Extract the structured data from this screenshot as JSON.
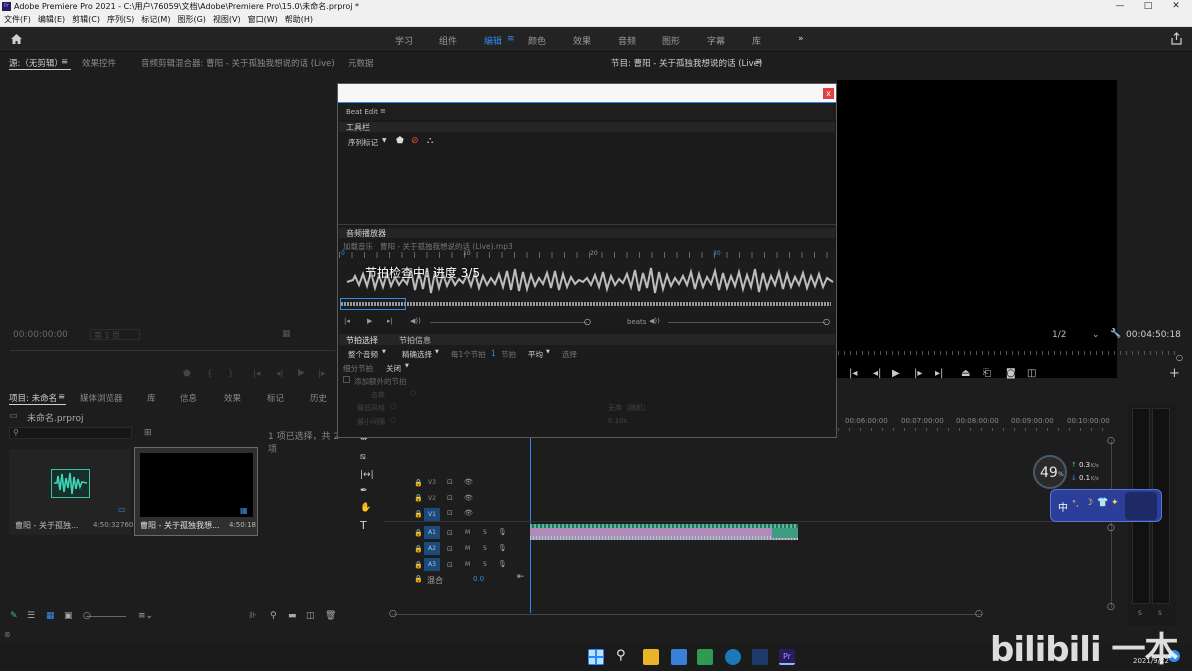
{
  "window": {
    "title": "Adobe Premiere Pro 2021 - C:\\用户\\76059\\文档\\Adobe\\Premiere Pro\\15.0\\未命名.prproj *",
    "minimize": "—",
    "maximize": "□",
    "close": "✕"
  },
  "menu": [
    "文件(F)",
    "编辑(E)",
    "剪辑(C)",
    "序列(S)",
    "标记(M)",
    "图形(G)",
    "视图(V)",
    "窗口(W)",
    "帮助(H)"
  ],
  "workspaces": {
    "items": [
      "学习",
      "组件",
      "编辑",
      "颜色",
      "效果",
      "音频",
      "图形",
      "字幕",
      "库"
    ],
    "active": "编辑",
    "more": "»"
  },
  "source_panel": {
    "tabs": [
      "源:（无剪辑）",
      "效果控件",
      "音频剪辑混合器: 曹阳 - 关于孤独我想说的话 (Live)",
      "元数据"
    ],
    "timecode": "00:00:00:00",
    "page": "第 1 页"
  },
  "program_panel": {
    "tab": "节目: 曹阳 - 关于孤独我想说的话 (Live)",
    "resolution": "1/2",
    "timecode": "00:04:50:18"
  },
  "project_panel": {
    "tabs": [
      "项目: 未命名",
      "媒体浏览器",
      "库",
      "信息",
      "效果",
      "标记",
      "历史"
    ],
    "file": "未命名.prproj",
    "selection": "1 项已选择，共 2 项",
    "items": [
      {
        "name": "曹阳 - 关于孤独...",
        "duration": "4:50:32760"
      },
      {
        "name": "曹阳 - 关于孤独我想...",
        "duration": "4:50:18"
      }
    ]
  },
  "beat_edit": {
    "title": "Beat Edit",
    "menu_icon": "≡",
    "close": "x",
    "toolbar": {
      "label": "工具栏",
      "sequence_marker": "序列标记"
    },
    "player": {
      "label": "音频播放器",
      "loaded_prefix": "加载音乐",
      "loaded_file": "曹阳 - 关于孤独我想说的话 (Live).mp3",
      "progress": "节拍检查中: 进度 3/5",
      "ruler": [
        "0",
        "10",
        "20",
        "30"
      ],
      "beats_label": "beats"
    },
    "tabs": [
      "节拍选择",
      "节拍信息"
    ],
    "selection": {
      "scope": "整个音频",
      "mode": "精确选择",
      "every": "每1个节拍",
      "count": "1",
      "unit": "节拍",
      "avg": "平均",
      "select": "选择"
    },
    "subdivide": {
      "label": "细分节拍",
      "value": "关闭"
    },
    "add_extra": "添加额外的节拍",
    "params": {
      "beat_label": "击数",
      "style_label": "最低风格",
      "style_value": "无序（随机）",
      "min_gap_label": "最小间隔",
      "min_gap_value": "0.10s"
    }
  },
  "timeline": {
    "ruler": [
      "00:06:00:00",
      "00:07:00:00",
      "00:08:00:00",
      "00:09:00:00",
      "00:10:00:00"
    ],
    "video_tracks": [
      "V3",
      "V2",
      "V1"
    ],
    "audio_tracks": [
      "A1",
      "A2",
      "A3"
    ],
    "mix_label": "混合",
    "mix_value": "0.0",
    "m": "M",
    "s": "S"
  },
  "overlay": {
    "cpu": "49",
    "cpu_unit": "%",
    "up": "0.3",
    "down": "0.1",
    "speed_unit": "K/s",
    "ime": "中"
  },
  "taskbar": {
    "date": "2021/9/22"
  },
  "watermark": "bilibili 一本",
  "colors": {
    "accent": "#2d8ceb",
    "clip_audio": "#2f8a72",
    "clip_video": "#b08ab8"
  }
}
